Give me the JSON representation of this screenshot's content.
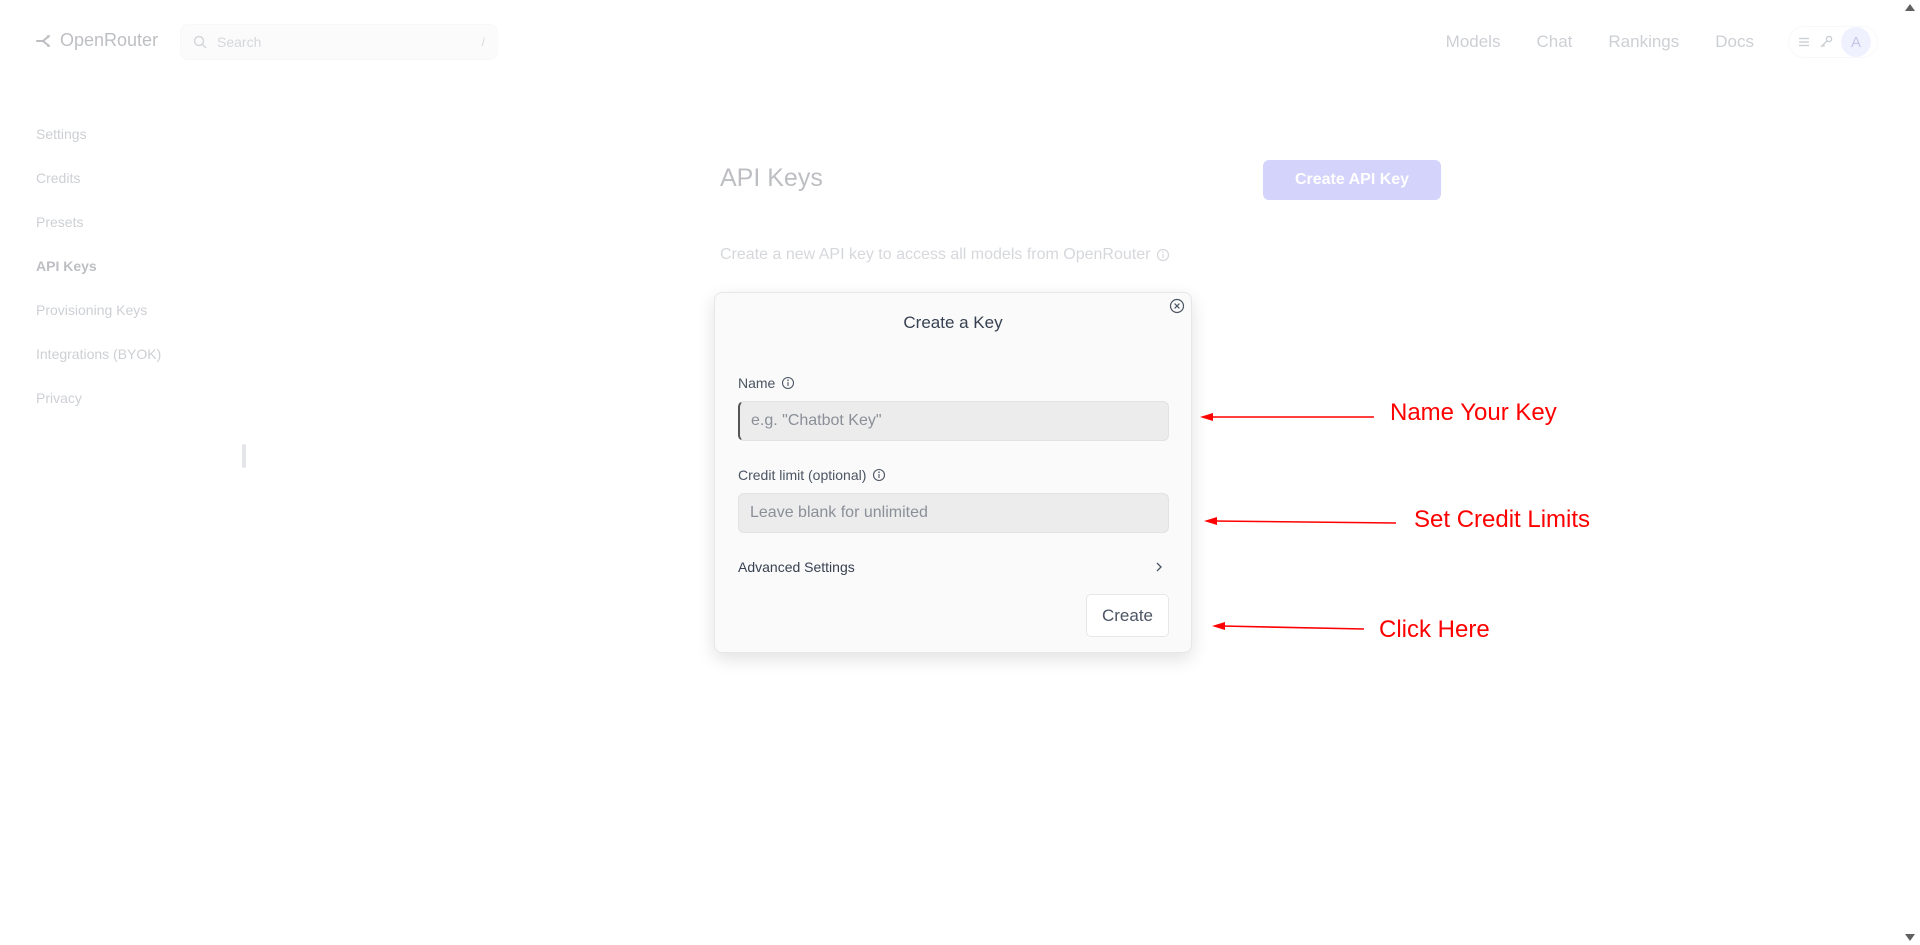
{
  "header": {
    "logo_text": "OpenRouter",
    "search_placeholder": "Search",
    "search_shortcut": "/",
    "nav": [
      "Models",
      "Chat",
      "Rankings",
      "Docs"
    ],
    "avatar_initial": "A"
  },
  "sidebar": {
    "items": [
      {
        "label": "Settings",
        "active": false
      },
      {
        "label": "Credits",
        "active": false
      },
      {
        "label": "Presets",
        "active": false
      },
      {
        "label": "API Keys",
        "active": true
      },
      {
        "label": "Provisioning Keys",
        "active": false
      },
      {
        "label": "Integrations (BYOK)",
        "active": false
      },
      {
        "label": "Privacy",
        "active": false
      }
    ]
  },
  "main": {
    "title": "API Keys",
    "create_button": "Create API Key",
    "description": "Create a new API key to access all models from OpenRouter"
  },
  "modal": {
    "title": "Create a Key",
    "name_label": "Name",
    "name_placeholder": "e.g. \"Chatbot Key\"",
    "credit_label": "Credit limit (optional)",
    "credit_placeholder": "Leave blank for unlimited",
    "advanced_label": "Advanced Settings",
    "create_label": "Create"
  },
  "annotations": {
    "name_your_key": "Name Your Key",
    "set_credit_limits": "Set Credit Limits",
    "click_here": "Click Here",
    "color": "#ff0000"
  },
  "colors": {
    "accent": "#6366f1",
    "annotation": "#ff0000"
  }
}
